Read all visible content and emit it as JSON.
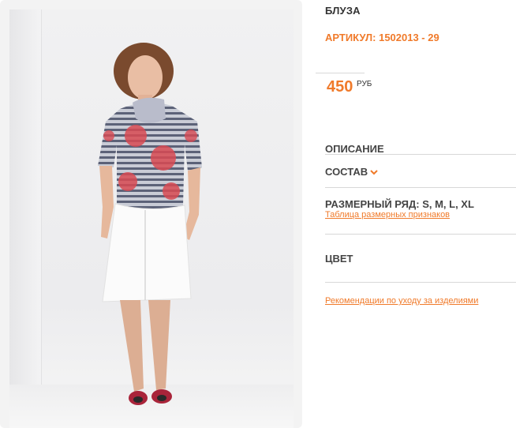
{
  "product": {
    "title": "БЛУЗА",
    "article": "АРТИКУЛ: 1502013 - 29",
    "price": "450",
    "currency": "РУБ"
  },
  "sections": {
    "description_label": "ОПИСАНИЕ",
    "composition_label": "СОСТАВ",
    "sizes_label": "РАЗМЕРНЫЙ РЯД: S, M, L, XL",
    "size_table_link": "Таблица размерных признаков",
    "color_label": "ЦВЕТ",
    "care_link": "Рекомендации по уходу за изделиями"
  },
  "colors": {
    "accent": "#f07a2a",
    "text": "#444444",
    "divider": "#d8d8d8"
  },
  "icons": {
    "composition_toggle": "chevron-down-icon"
  }
}
